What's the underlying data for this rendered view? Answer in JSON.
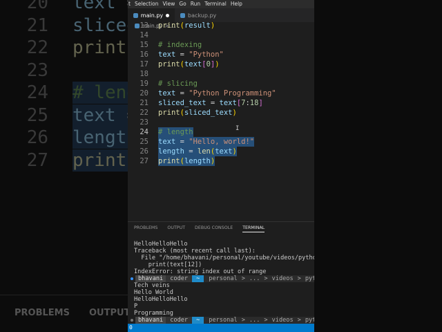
{
  "menu": [
    "t",
    "Selection",
    "View",
    "Go",
    "Run",
    "Terminal",
    "Help"
  ],
  "tabs": [
    {
      "label": "main.py",
      "modified": true
    },
    {
      "label": "backup.py"
    }
  ],
  "breadcrumb": {
    "file": "main.py",
    "sep": ">",
    "rest": "..."
  },
  "code": [
    {
      "n": "13",
      "t": [
        [
          "print",
          "kw"
        ],
        [
          "(",
          "br2"
        ],
        [
          "result",
          "var"
        ],
        [
          ")",
          "br2"
        ]
      ]
    },
    {
      "n": "14",
      "t": []
    },
    {
      "n": "15",
      "t": [
        [
          "# indexing",
          "cm"
        ]
      ]
    },
    {
      "n": "16",
      "t": [
        [
          "text",
          "var"
        ],
        [
          " = ",
          "op"
        ],
        [
          "\"Python\"",
          "str"
        ]
      ]
    },
    {
      "n": "17",
      "t": [
        [
          "print",
          "kw"
        ],
        [
          "(",
          "br2"
        ],
        [
          "text",
          "var"
        ],
        [
          "[",
          "br"
        ],
        [
          "0",
          "nm"
        ],
        [
          "]",
          "br"
        ],
        [
          ")",
          "br2"
        ]
      ]
    },
    {
      "n": "18",
      "t": []
    },
    {
      "n": "19",
      "t": [
        [
          "# slicing",
          "cm"
        ]
      ]
    },
    {
      "n": "20",
      "t": [
        [
          "text",
          "var"
        ],
        [
          " = ",
          "op"
        ],
        [
          "\"Python Programming\"",
          "str"
        ]
      ]
    },
    {
      "n": "21",
      "t": [
        [
          "sliced_text",
          "var"
        ],
        [
          " = ",
          "op"
        ],
        [
          "text",
          "var"
        ],
        [
          "[",
          "br"
        ],
        [
          "7",
          "nm"
        ],
        [
          ":",
          "op"
        ],
        [
          "18",
          "nm"
        ],
        [
          "]",
          "br"
        ]
      ]
    },
    {
      "n": "22",
      "t": [
        [
          "print",
          "kw"
        ],
        [
          "(",
          "br2"
        ],
        [
          "sliced_text",
          "var"
        ],
        [
          ")",
          "br2"
        ]
      ]
    },
    {
      "n": "23",
      "t": []
    },
    {
      "n": "24",
      "t": [
        [
          "# length",
          "cm"
        ]
      ],
      "sel": true,
      "cur": true
    },
    {
      "n": "25",
      "t": [
        [
          "text",
          "var"
        ],
        [
          " = ",
          "op"
        ],
        [
          "\"Hello, world!\"",
          "str"
        ]
      ],
      "sel": true
    },
    {
      "n": "26",
      "t": [
        [
          "length",
          "var"
        ],
        [
          " = ",
          "op"
        ],
        [
          "len",
          "kw"
        ],
        [
          "(",
          "br2"
        ],
        [
          "text",
          "var"
        ],
        [
          ")",
          "br2"
        ]
      ],
      "sel": true
    },
    {
      "n": "27",
      "t": [
        [
          "print",
          "kw"
        ],
        [
          "(",
          "br2"
        ],
        [
          "length",
          "var"
        ],
        [
          ")",
          "br2"
        ]
      ],
      "sel": true
    }
  ],
  "panel_tabs": [
    "PROBLEMS",
    "OUTPUT",
    "DEBUG CONSOLE",
    "TERMINAL"
  ],
  "terminal_before": [
    "HelloHelloHello",
    "Traceback (most recent call last):",
    "  File \"/home/bhavani/personal/youtube/videos/python/da",
    "    print(text[12])",
    "IndexError: string index out of range"
  ],
  "prompt": {
    "user": "bhavani",
    "host": "coder",
    "mark": "~",
    "path": [
      "personal",
      ">",
      "...",
      ">",
      "videos",
      ">",
      "python",
      ">"
    ]
  },
  "terminal_after": [
    "Tech veins",
    "Hello World",
    "HelloHelloHello",
    "P",
    "Programming"
  ],
  "status": {
    "text": "0"
  },
  "background": {
    "panel_tabs": [
      "PROBLEMS",
      "OUTPUT"
    ]
  }
}
